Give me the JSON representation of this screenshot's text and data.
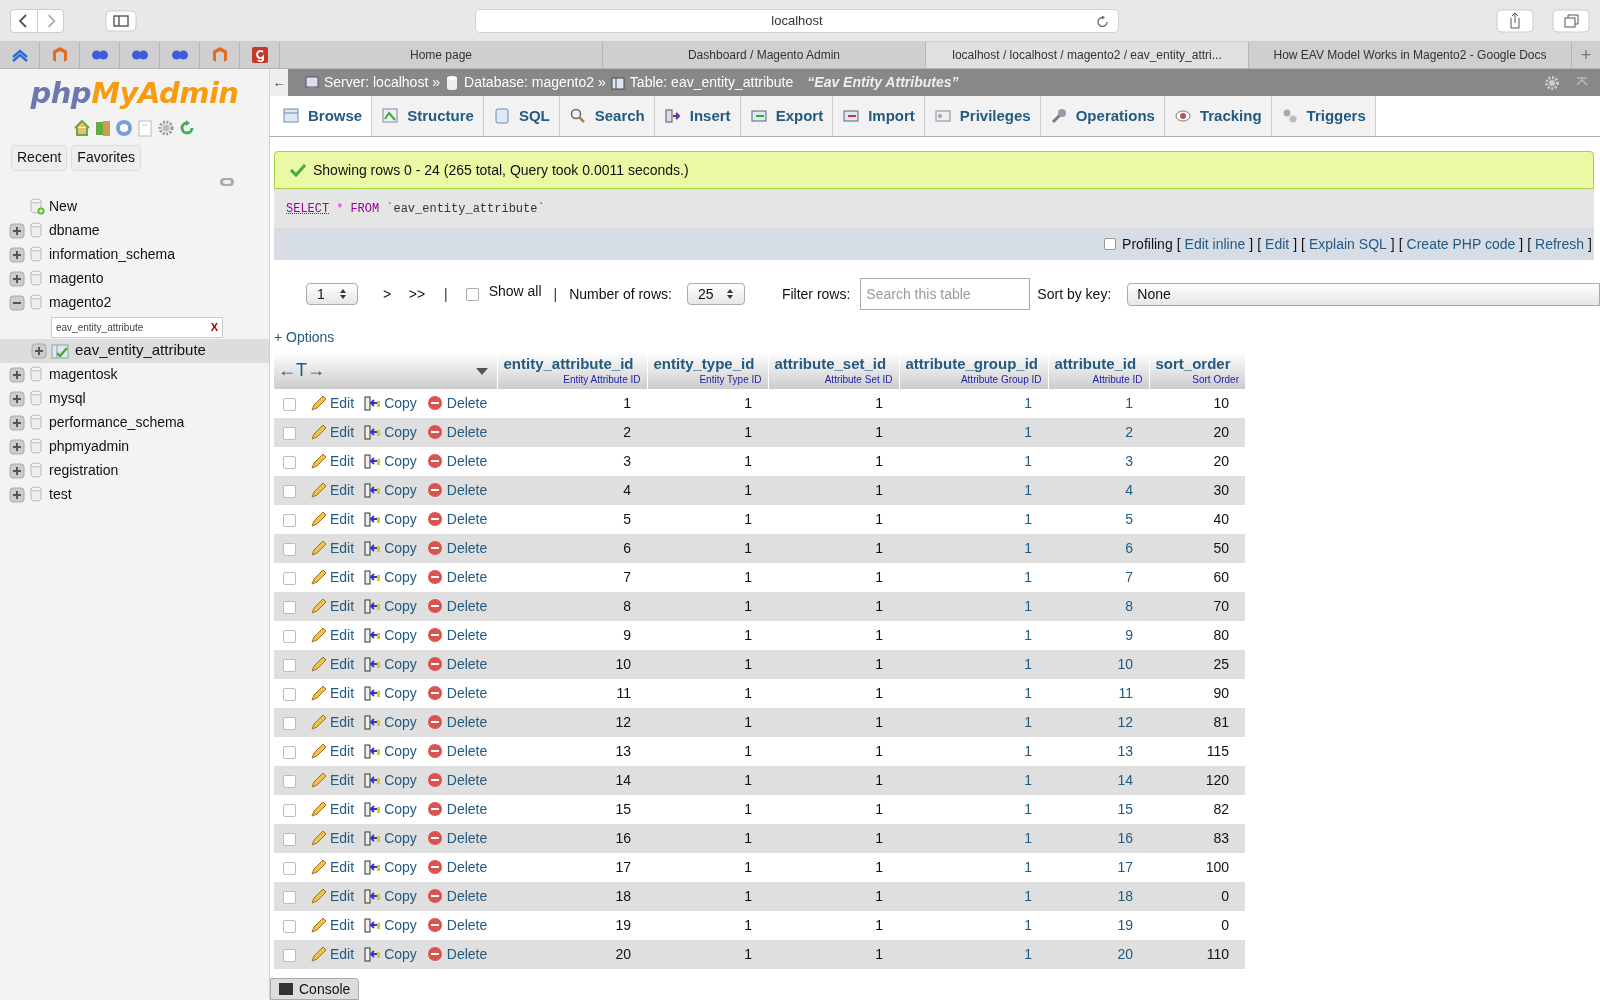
{
  "browser": {
    "url": "localhost",
    "pinned": [
      {
        "kind": "stack"
      },
      {
        "kind": "magento"
      },
      {
        "kind": "flickr"
      },
      {
        "kind": "flickr"
      },
      {
        "kind": "flickr"
      },
      {
        "kind": "magento"
      },
      {
        "kind": "g"
      }
    ],
    "tabs": [
      {
        "label": "Home page",
        "selected": false
      },
      {
        "label": "Dashboard / Magento Admin",
        "selected": false
      },
      {
        "label": "localhost / localhost / magento2 / eav_entity_attri...",
        "selected": true
      },
      {
        "label": "How EAV Model Works in Magento2 - Google Docs",
        "selected": false
      }
    ],
    "new_tab": "+"
  },
  "sidebar": {
    "logo": {
      "php": "php",
      "myadmin": "MyAdmin"
    },
    "buttons": [
      "Recent",
      "Favorites"
    ],
    "tree": [
      {
        "label": "New",
        "kind": "new"
      },
      {
        "label": "dbname",
        "kind": "database",
        "expanded": false
      },
      {
        "label": "information_schema",
        "kind": "database",
        "expanded": false
      },
      {
        "label": "magento",
        "kind": "database",
        "expanded": false
      },
      {
        "label": "magento2",
        "kind": "database",
        "expanded": true,
        "filter": {
          "value": "eav_entity_attribute",
          "clear": "X"
        },
        "children": [
          {
            "label": "eav_entity_attribute",
            "kind": "table",
            "expanded": false,
            "selected": true
          }
        ]
      },
      {
        "label": "magentosk",
        "kind": "database",
        "expanded": false
      },
      {
        "label": "mysql",
        "kind": "database",
        "expanded": false
      },
      {
        "label": "performance_schema",
        "kind": "database",
        "expanded": false
      },
      {
        "label": "phpmyadmin",
        "kind": "database",
        "expanded": false
      },
      {
        "label": "registration",
        "kind": "database",
        "expanded": false
      },
      {
        "label": "test",
        "kind": "database",
        "expanded": false
      }
    ]
  },
  "breadcrumb": {
    "back": "←",
    "server": "Server: localhost",
    "database": "Database: magento2",
    "table": "Table: eav_entity_attribute",
    "separator": "»",
    "comment": "“Eav Entity Attributes”"
  },
  "tabs": [
    {
      "label": "Browse",
      "selected": true
    },
    {
      "label": "Structure",
      "selected": false
    },
    {
      "label": "SQL",
      "selected": false
    },
    {
      "label": "Search",
      "selected": false
    },
    {
      "label": "Insert",
      "selected": false
    },
    {
      "label": "Export",
      "selected": false
    },
    {
      "label": "Import",
      "selected": false
    },
    {
      "label": "Privileges",
      "selected": false
    },
    {
      "label": "Operations",
      "selected": false
    },
    {
      "label": "Tracking",
      "selected": false
    },
    {
      "label": "Triggers",
      "selected": false
    }
  ],
  "message": "Showing rows 0 - 24 (265 total, Query took 0.0011 seconds.)",
  "query": {
    "select": "SELECT",
    "star": "*",
    "from": "FROM",
    "table": "`eav_entity_attribute`"
  },
  "profiling": {
    "checked": false,
    "label": "Profiling",
    "links": [
      {
        "open": "[",
        "label": "Edit inline",
        "close": "]"
      },
      {
        "open": "[",
        "label": "Edit",
        "close": "]"
      },
      {
        "open": "[",
        "label": "Explain SQL",
        "close": "]"
      },
      {
        "open": "[",
        "label": "Create PHP code",
        "close": "]"
      },
      {
        "open": "[",
        "label": "Refresh",
        "close": "]"
      }
    ]
  },
  "navigation": {
    "page": "1",
    "next": ">",
    "last": ">>",
    "separator": "|",
    "show_all": {
      "label": "Show all",
      "checked": false
    },
    "rows_label": "Number of rows:",
    "rows": "25",
    "filter_label": "Filter rows:",
    "filter_placeholder": "Search this table",
    "sort_label": "Sort by key:",
    "sort": "None"
  },
  "options": "+ Options",
  "table": {
    "arrows": "←T→",
    "columns": [
      {
        "name": "entity_attribute_id",
        "comment": "Entity Attribute ID",
        "link": false
      },
      {
        "name": "entity_type_id",
        "comment": "Entity Type ID",
        "link": false
      },
      {
        "name": "attribute_set_id",
        "comment": "Attribute Set ID",
        "link": false
      },
      {
        "name": "attribute_group_id",
        "comment": "Attribute Group ID",
        "link": true
      },
      {
        "name": "attribute_id",
        "comment": "Attribute ID",
        "link": true
      },
      {
        "name": "sort_order",
        "comment": "Sort Order",
        "link": false
      }
    ],
    "rows": [
      {
        "checked": false,
        "actions": [
          "Edit",
          "Copy",
          "Delete"
        ],
        "cells": [
          "1",
          "1",
          "1",
          "1",
          "1",
          "10"
        ]
      },
      {
        "checked": false,
        "actions": [
          "Edit",
          "Copy",
          "Delete"
        ],
        "cells": [
          "2",
          "1",
          "1",
          "1",
          "2",
          "20"
        ]
      },
      {
        "checked": false,
        "actions": [
          "Edit",
          "Copy",
          "Delete"
        ],
        "cells": [
          "3",
          "1",
          "1",
          "1",
          "3",
          "20"
        ]
      },
      {
        "checked": false,
        "actions": [
          "Edit",
          "Copy",
          "Delete"
        ],
        "cells": [
          "4",
          "1",
          "1",
          "1",
          "4",
          "30"
        ]
      },
      {
        "checked": false,
        "actions": [
          "Edit",
          "Copy",
          "Delete"
        ],
        "cells": [
          "5",
          "1",
          "1",
          "1",
          "5",
          "40"
        ]
      },
      {
        "checked": false,
        "actions": [
          "Edit",
          "Copy",
          "Delete"
        ],
        "cells": [
          "6",
          "1",
          "1",
          "1",
          "6",
          "50"
        ]
      },
      {
        "checked": false,
        "actions": [
          "Edit",
          "Copy",
          "Delete"
        ],
        "cells": [
          "7",
          "1",
          "1",
          "1",
          "7",
          "60"
        ]
      },
      {
        "checked": false,
        "actions": [
          "Edit",
          "Copy",
          "Delete"
        ],
        "cells": [
          "8",
          "1",
          "1",
          "1",
          "8",
          "70"
        ]
      },
      {
        "checked": false,
        "actions": [
          "Edit",
          "Copy",
          "Delete"
        ],
        "cells": [
          "9",
          "1",
          "1",
          "1",
          "9",
          "80"
        ]
      },
      {
        "checked": false,
        "actions": [
          "Edit",
          "Copy",
          "Delete"
        ],
        "cells": [
          "10",
          "1",
          "1",
          "1",
          "10",
          "25"
        ]
      },
      {
        "checked": false,
        "actions": [
          "Edit",
          "Copy",
          "Delete"
        ],
        "cells": [
          "11",
          "1",
          "1",
          "1",
          "11",
          "90"
        ]
      },
      {
        "checked": false,
        "actions": [
          "Edit",
          "Copy",
          "Delete"
        ],
        "cells": [
          "12",
          "1",
          "1",
          "1",
          "12",
          "81"
        ]
      },
      {
        "checked": false,
        "actions": [
          "Edit",
          "Copy",
          "Delete"
        ],
        "cells": [
          "13",
          "1",
          "1",
          "1",
          "13",
          "115"
        ]
      },
      {
        "checked": false,
        "actions": [
          "Edit",
          "Copy",
          "Delete"
        ],
        "cells": [
          "14",
          "1",
          "1",
          "1",
          "14",
          "120"
        ]
      },
      {
        "checked": false,
        "actions": [
          "Edit",
          "Copy",
          "Delete"
        ],
        "cells": [
          "15",
          "1",
          "1",
          "1",
          "15",
          "82"
        ]
      },
      {
        "checked": false,
        "actions": [
          "Edit",
          "Copy",
          "Delete"
        ],
        "cells": [
          "16",
          "1",
          "1",
          "1",
          "16",
          "83"
        ]
      },
      {
        "checked": false,
        "actions": [
          "Edit",
          "Copy",
          "Delete"
        ],
        "cells": [
          "17",
          "1",
          "1",
          "1",
          "17",
          "100"
        ]
      },
      {
        "checked": false,
        "actions": [
          "Edit",
          "Copy",
          "Delete"
        ],
        "cells": [
          "18",
          "1",
          "1",
          "1",
          "18",
          "0"
        ]
      },
      {
        "checked": false,
        "actions": [
          "Edit",
          "Copy",
          "Delete"
        ],
        "cells": [
          "19",
          "1",
          "1",
          "1",
          "19",
          "0"
        ]
      },
      {
        "checked": false,
        "actions": [
          "Edit",
          "Copy",
          "Delete"
        ],
        "cells": [
          "20",
          "1",
          "1",
          "1",
          "20",
          "110"
        ]
      }
    ]
  },
  "console": "Console"
}
